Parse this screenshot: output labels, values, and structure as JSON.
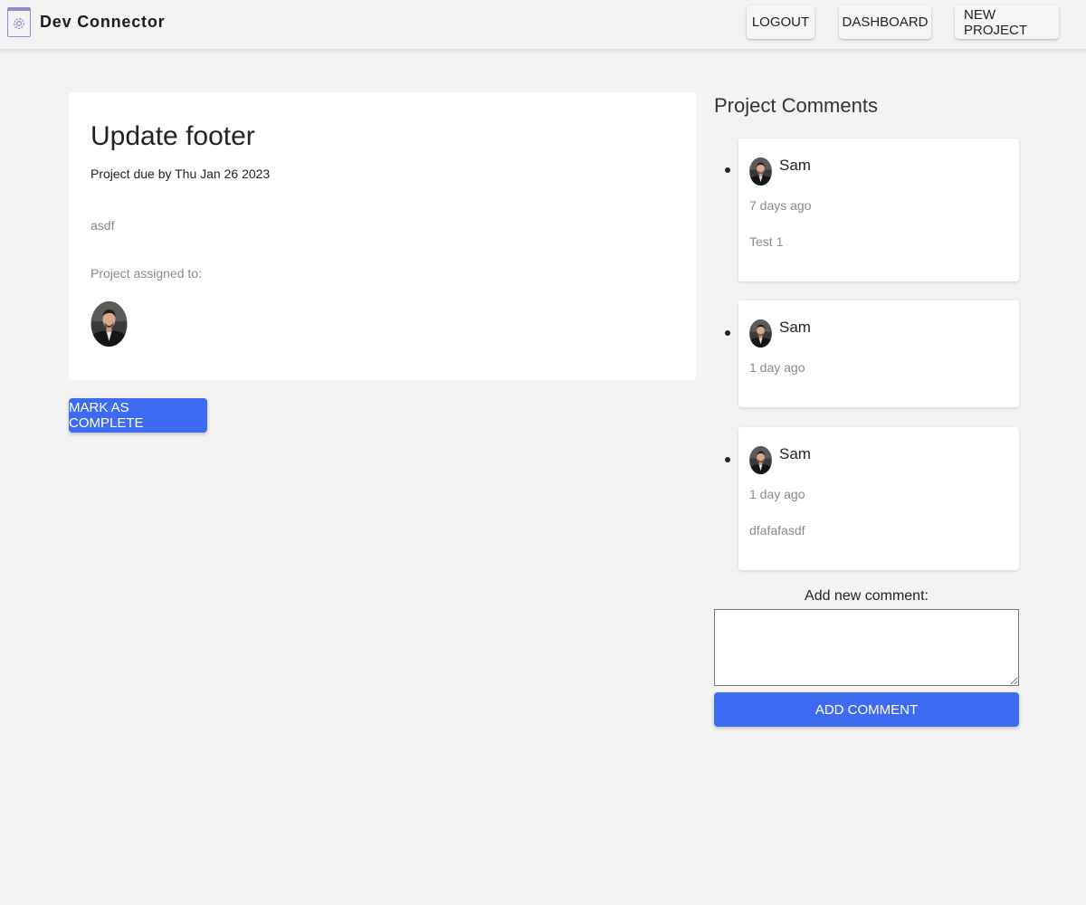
{
  "app": {
    "title": "Dev Connector",
    "logo_icon": "gear-window-icon",
    "accent_color": "#3d6cf3"
  },
  "nav": {
    "logout_label": "LOGOUT",
    "dashboard_label": "DASHBOARD",
    "new_project_label": "NEW PROJECT"
  },
  "project": {
    "title": "Update footer",
    "due": "Project due by Thu Jan 26 2023",
    "description": "asdf",
    "assigned_label": "Project assigned to:",
    "complete_label": "MARK AS COMPLETE"
  },
  "comments": {
    "heading": "Project Comments",
    "items": [
      {
        "author": "Sam",
        "time": "7 days ago",
        "text": "Test 1"
      },
      {
        "author": "Sam",
        "time": "1 day ago",
        "text": ""
      },
      {
        "author": "Sam",
        "time": "1 day ago",
        "text": "dfafafasdf"
      }
    ],
    "add_label": "Add new comment:",
    "input_value": "",
    "add_button_label": "ADD COMMENT"
  }
}
